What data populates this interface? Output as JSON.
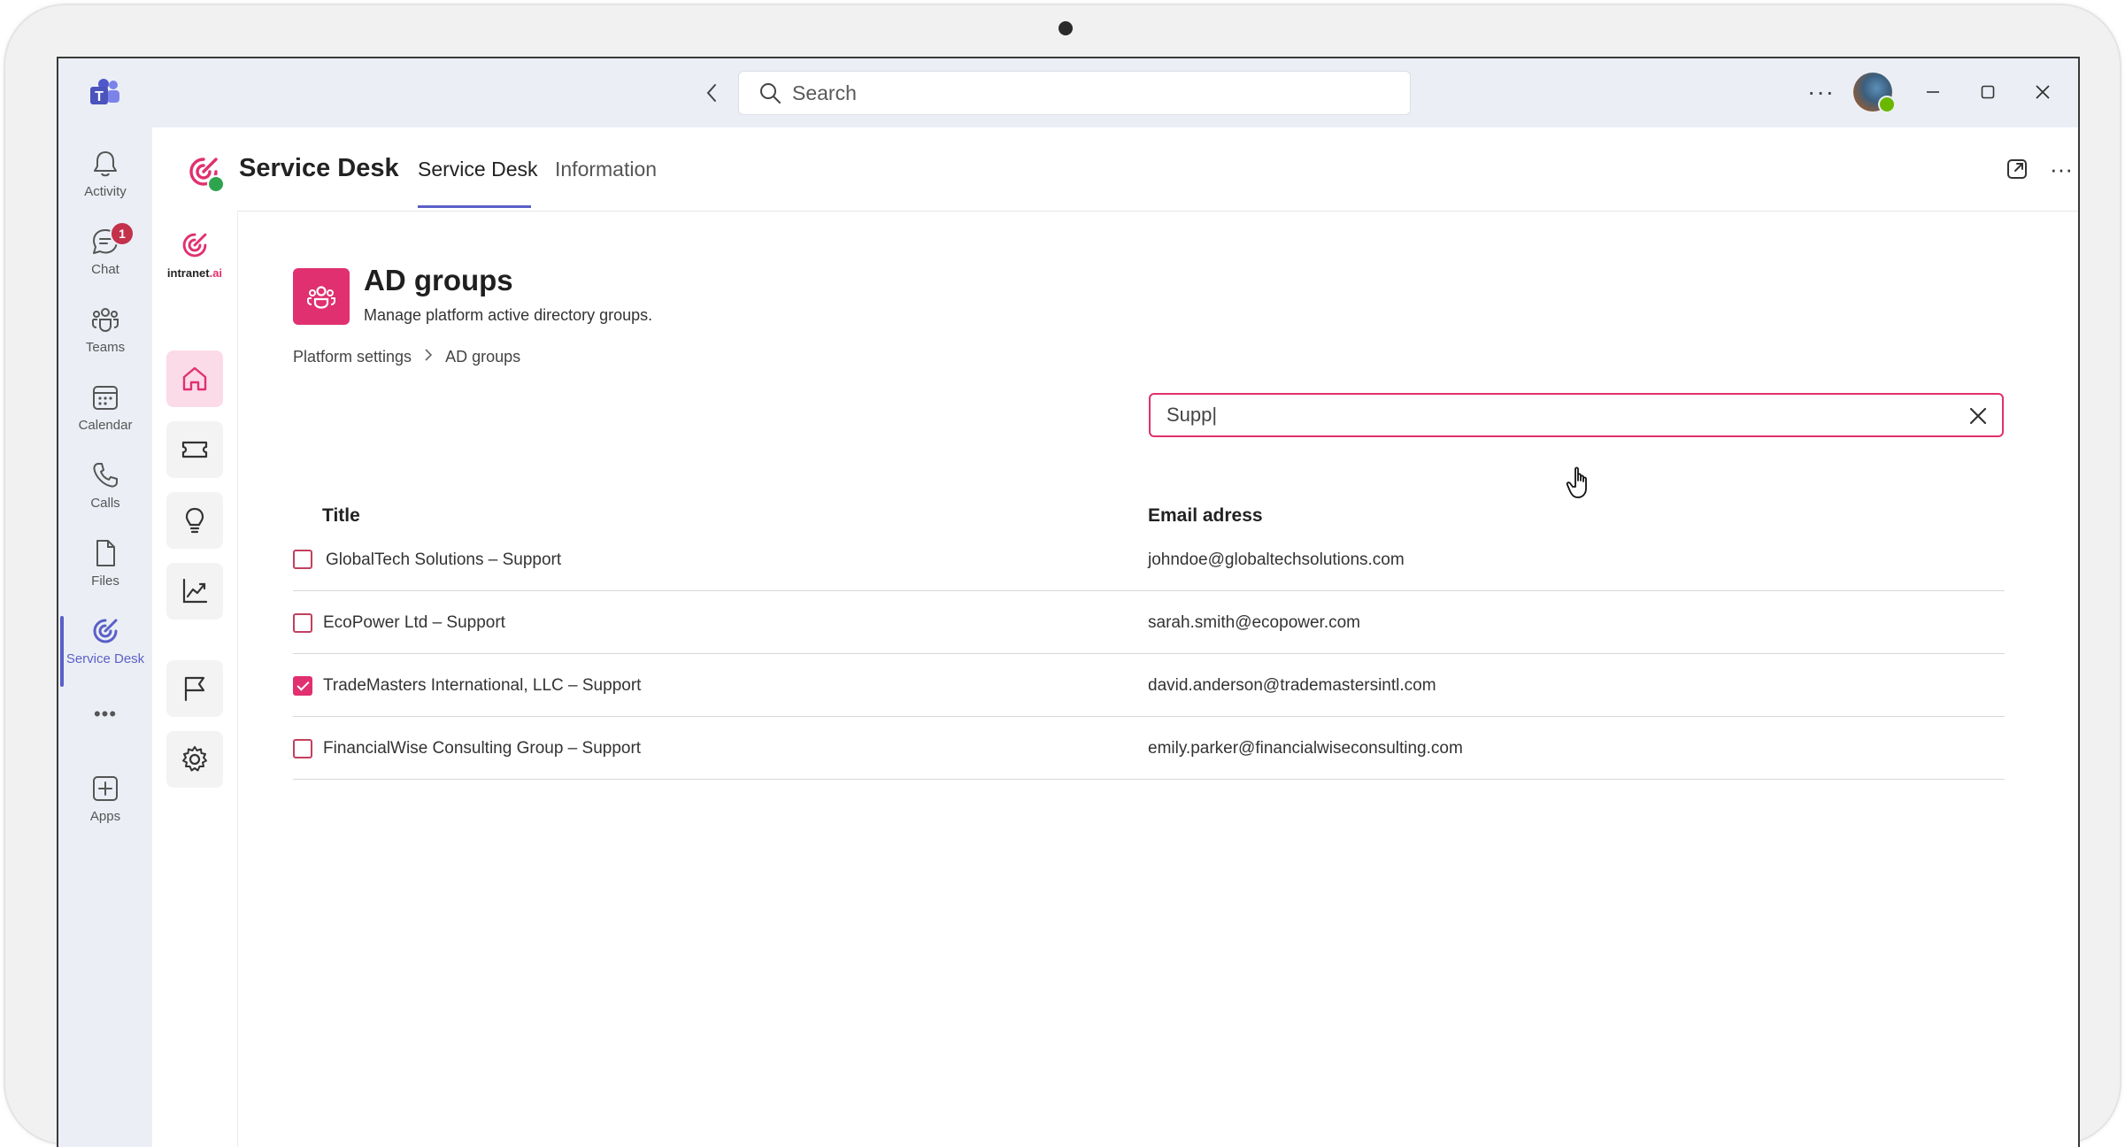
{
  "titlebar": {
    "search_placeholder": "Search",
    "more": "···"
  },
  "rail": {
    "items": [
      {
        "label": "Activity",
        "icon": "bell-icon"
      },
      {
        "label": "Chat",
        "icon": "chat-icon",
        "badge": "1"
      },
      {
        "label": "Teams",
        "icon": "teams-icon"
      },
      {
        "label": "Calendar",
        "icon": "calendar-icon"
      },
      {
        "label": "Calls",
        "icon": "phone-icon"
      },
      {
        "label": "Files",
        "icon": "file-icon"
      },
      {
        "label": "Service Desk",
        "icon": "service-desk-icon",
        "active": true
      },
      {
        "label": "Apps",
        "icon": "add-app-icon"
      }
    ],
    "more": "•••"
  },
  "app_header": {
    "title": "Service Desk",
    "tabs": [
      {
        "label": "Service Desk",
        "active": true
      },
      {
        "label": "Information",
        "active": false
      }
    ]
  },
  "app_sidebar": {
    "logo_text": "intranet",
    "logo_suffix": ".ai"
  },
  "page": {
    "title": "AD groups",
    "subtitle": "Manage platform active directory groups.",
    "breadcrumb": [
      "Platform settings",
      "AD groups"
    ],
    "filter_value": "Supp|"
  },
  "table": {
    "headers": [
      "Title",
      "Email adress"
    ],
    "rows": [
      {
        "title": "GlobalTech Solutions – Support",
        "email": "johndoe@globaltechsolutions.com",
        "checked": false
      },
      {
        "title": "EcoPower Ltd – Support",
        "email": "sarah.smith@ecopower.com",
        "checked": false
      },
      {
        "title": "TradeMasters International, LLC – Support",
        "email": "david.anderson@trademastersintl.com",
        "checked": true
      },
      {
        "title": "FinancialWise Consulting Group – Support",
        "email": "emily.parker@financialwiseconsulting.com",
        "checked": false
      }
    ]
  },
  "colors": {
    "accent": "#e0306f",
    "teams_purple": "#5b5fc7",
    "rail_bg": "#ebeff5"
  }
}
